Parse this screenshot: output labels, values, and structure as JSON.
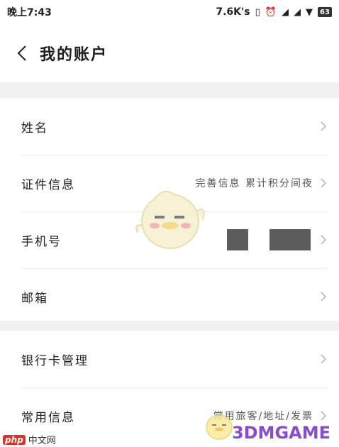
{
  "status": {
    "time": "晚上7:43",
    "speed": "7.6K's",
    "battery": "63"
  },
  "header": {
    "title": "我的账户"
  },
  "account_group": [
    {
      "label": "姓名",
      "value": ""
    },
    {
      "label": "证件信息",
      "value": "完善信息 累计积分间夜"
    },
    {
      "label": "手机号",
      "value": ""
    },
    {
      "label": "邮箱",
      "value": ""
    }
  ],
  "other_group": [
    {
      "label": "银行卡管理",
      "value": ""
    },
    {
      "label": "常用信息",
      "value": "常用旅客/地址/发票"
    }
  ],
  "watermarks": {
    "left_badge": "php",
    "left_text": "中文网",
    "right_text": "3DMGAME"
  },
  "colors": {
    "background": "#f2f2f4",
    "card": "#ffffff",
    "chevron": "#b8b8b8",
    "watermark_brand": "#8a4bd0"
  }
}
